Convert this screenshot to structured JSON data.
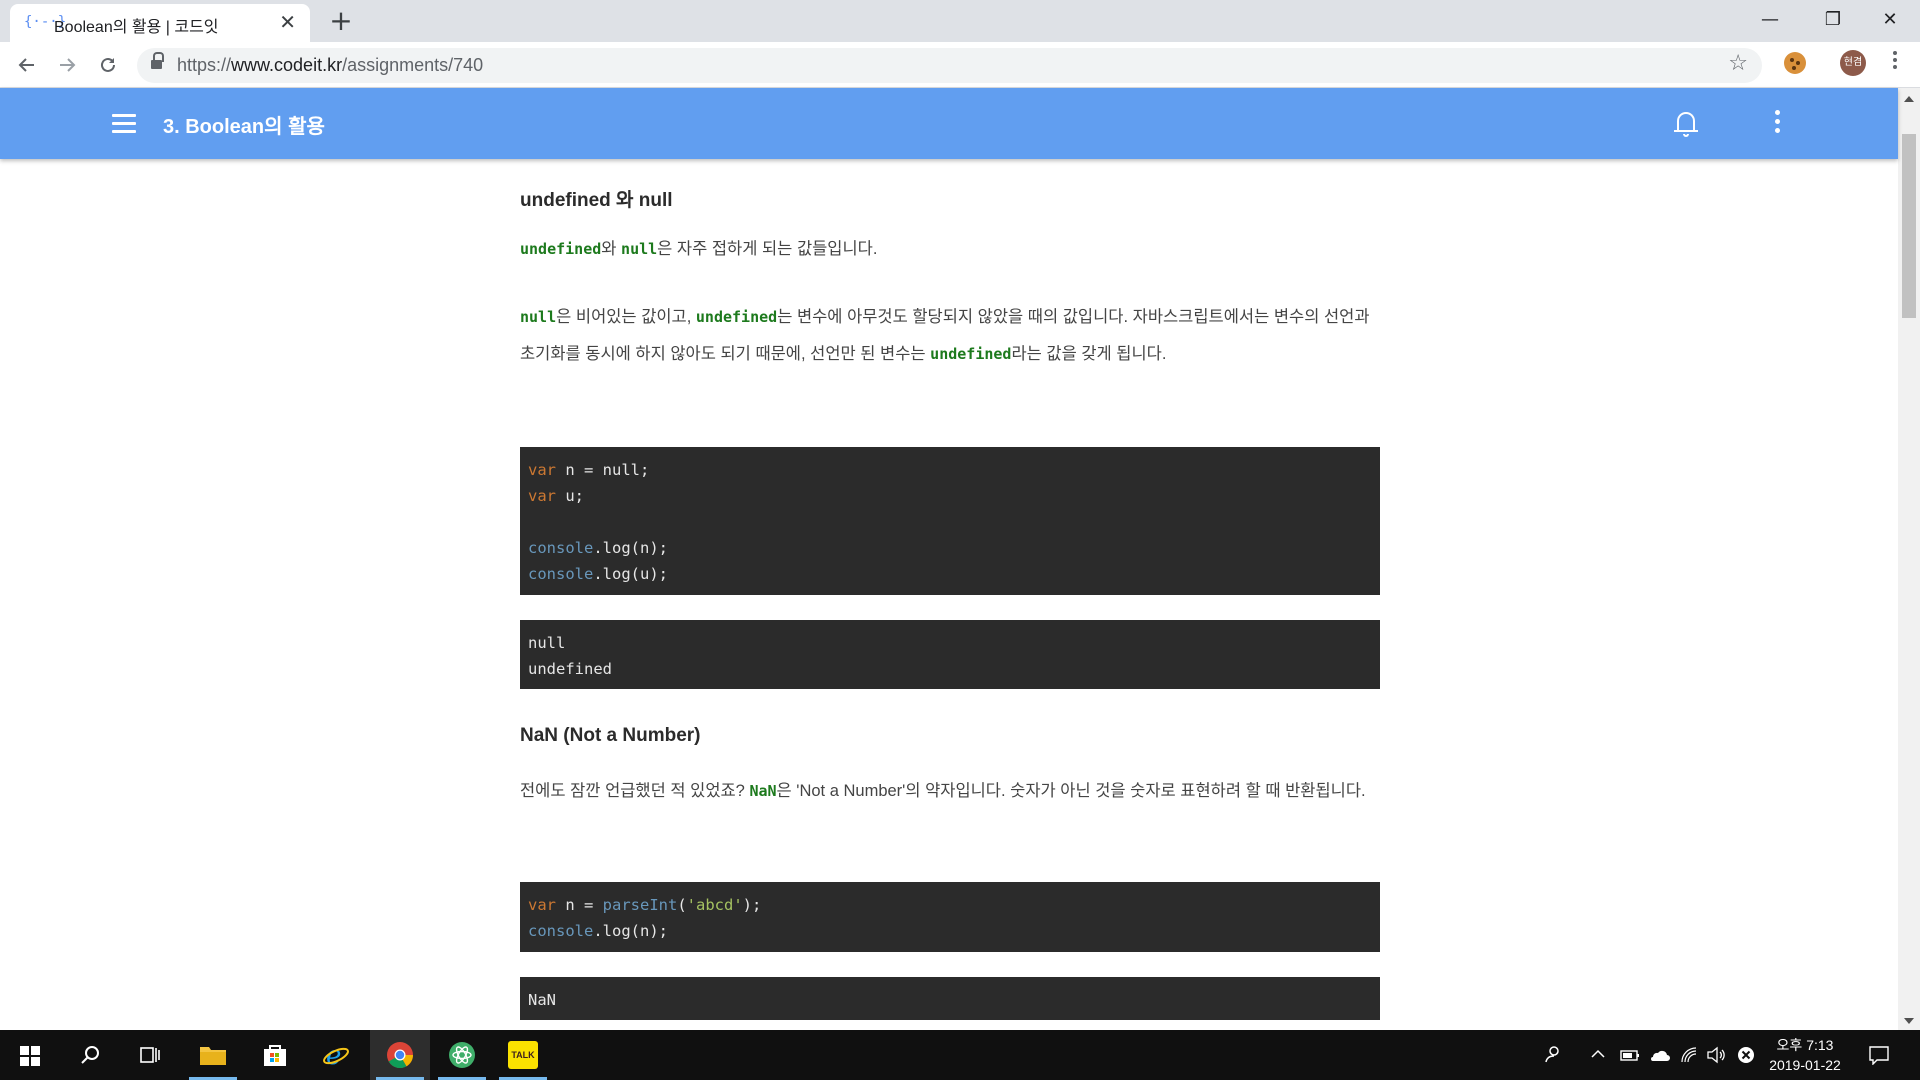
{
  "browser": {
    "tab_title": "Boolean의 활용 | 코드잇",
    "tab_favicon": "{·-·}",
    "tab_close": "✕",
    "new_tab": "+",
    "url_prefix": "https://",
    "url_host": "www.codeit.kr",
    "url_path": "/assignments/740",
    "profile_initials": "현겸",
    "icons": [
      "back-icon",
      "forward-icon",
      "reload-icon",
      "lock-icon",
      "star-icon",
      "cookie-extension-icon",
      "chrome-menu-icon"
    ]
  },
  "window_controls": {
    "minimize": "—",
    "maximize": "❐",
    "close": "✕"
  },
  "appbar": {
    "title": "3. Boolean의 활용",
    "background_color": "#619ef0",
    "icons": [
      "hamburger-menu-icon",
      "bell-icon",
      "more-vertical-icon"
    ]
  },
  "content": {
    "section1": {
      "heading": "undefined 와 null",
      "p1": {
        "c1": "undefined",
        "t1": "와 ",
        "c2": "null",
        "t2": "은 자주 접하게 되는 값들입니다."
      },
      "p2": {
        "c1": "null",
        "t1": "은 비어있는 값이고, ",
        "c2": "undefined",
        "t2": "는 변수에 아무것도 할당되지 않았을 때의 값입니다. 자바스크립트에서는 변수의 선언과 초기화를 동시에 하지 않아도 되기 때문에, 선언만 된 변수는 ",
        "c3": "undefined",
        "t3": "라는 값을 갖게 됩니다."
      },
      "code": {
        "l1_kw": "var",
        "l1_rest": " n = null;",
        "l2_kw": "var",
        "l2_rest": " u;",
        "l4_obj": "console",
        "l4_rest": ".log(n);",
        "l5_obj": "console",
        "l5_rest": ".log(u);"
      },
      "output": {
        "l1": "null",
        "l2": "undefined"
      }
    },
    "section2": {
      "heading": "NaN (Not a Number)",
      "p1": {
        "t1": "전에도 잠깐 언급했던 적 있었죠? ",
        "c1": "NaN",
        "t2": "은 'Not a Number'의 약자입니다. 숫자가 아닌 것을 숫자로 표현하려 할 때 반환됩니다."
      },
      "code": {
        "l1_kw": "var",
        "l1_mid": " n = ",
        "l1_fn": "parseInt",
        "l1_p1": "(",
        "l1_str": "'abcd'",
        "l1_p2": ");",
        "l2_obj": "console",
        "l2_rest": ".log(n);"
      },
      "output": {
        "l1": "NaN"
      }
    },
    "colors": {
      "code_bg": "#2b2b2b",
      "keyword": "#cc7832",
      "object": "#6897bb",
      "string": "#a5c261",
      "inline_code": "#1d7a1d"
    }
  },
  "taskbar": {
    "clock_line1": "오후 7:13",
    "clock_line2": "2019-01-22",
    "apps": [
      "start-icon",
      "search-icon",
      "task-view-icon",
      "file-explorer-icon",
      "store-icon",
      "internet-explorer-icon",
      "chrome-icon",
      "atom-icon",
      "kakaotalk-icon"
    ],
    "kakao_label": "TALK",
    "tray": [
      "people-icon",
      "chevron-up-icon",
      "battery-icon",
      "onedrive-icon",
      "wifi-icon",
      "volume-icon",
      "close-circle-icon",
      "notifications-icon"
    ]
  }
}
